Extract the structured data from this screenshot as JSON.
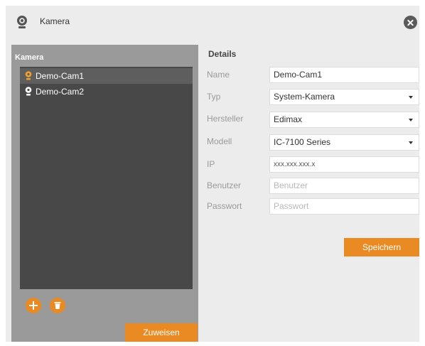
{
  "window": {
    "title": "Kamera",
    "close_icon": "close-icon",
    "title_icon": "webcam-icon"
  },
  "left": {
    "title": "Kamera",
    "cameras": [
      {
        "label": "Demo-Cam1",
        "icon": "webcam-icon",
        "icon_color": "#f0a030",
        "selected": true
      },
      {
        "label": "Demo-Cam2",
        "icon": "webcam-icon",
        "icon_color": "#ffffff",
        "selected": false
      }
    ],
    "add_icon": "plus-icon",
    "delete_icon": "trash-icon",
    "assign_label": "Zuweisen"
  },
  "details": {
    "title": "Details",
    "fields": {
      "name": {
        "label": "Name",
        "value": "Demo-Cam1"
      },
      "typ": {
        "label": "Typ",
        "value": "System-Kamera"
      },
      "hersteller": {
        "label": "Hersteller",
        "value": "Edimax"
      },
      "modell": {
        "label": "Modell",
        "value": "IC-7100 Series"
      },
      "ip": {
        "label": "IP",
        "value": "xxx.xxx.xxx.x"
      },
      "benutzer": {
        "label": "Benutzer",
        "value": "",
        "placeholder": "Benutzer"
      },
      "passwort": {
        "label": "Passwort",
        "value": "",
        "placeholder": "Passwort"
      }
    },
    "save_label": "Speichern"
  },
  "colors": {
    "accent": "#ea8a22",
    "list_bg": "#484848",
    "panel_bg": "#9a9a9a",
    "dialog_bg": "#ececec"
  }
}
